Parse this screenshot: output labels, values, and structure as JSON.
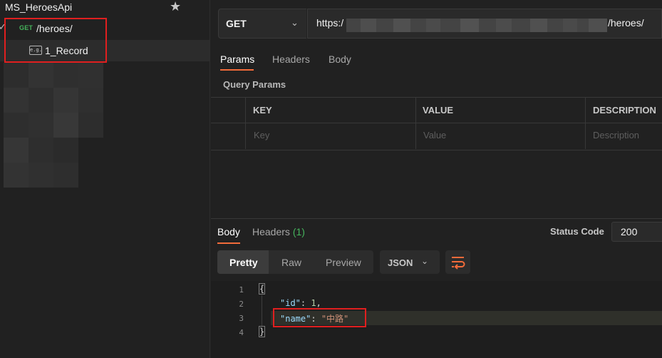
{
  "sidebar": {
    "collection_name": "MS_HeroesApi",
    "request": {
      "method": "GET",
      "path": "/heroes/"
    },
    "example": {
      "icon": "example-icon",
      "icon_text": "e.g.",
      "name": "1_Record"
    }
  },
  "request_bar": {
    "method": "GET",
    "url_prefix": "https:/",
    "url_suffix": "/heroes/"
  },
  "request_tabs": [
    "Params",
    "Headers",
    "Body"
  ],
  "query_params": {
    "label": "Query Params",
    "columns": [
      "KEY",
      "VALUE",
      "DESCRIPTION"
    ],
    "placeholders": [
      "Key",
      "Value",
      "Description"
    ]
  },
  "response": {
    "tabs": {
      "body": "Body",
      "headers": "Headers",
      "headers_count": "(1)"
    },
    "status_label": "Status Code",
    "status_value": "200",
    "view_modes": [
      "Pretty",
      "Raw",
      "Preview"
    ],
    "format": "JSON",
    "lines": [
      "1",
      "2",
      "3",
      "4"
    ],
    "code": {
      "open": "{",
      "key_id": "\"id\"",
      "val_id": "1",
      "key_name": "\"name\"",
      "val_name": "\"中路\"",
      "close": "}"
    }
  },
  "colors": {
    "accent": "#f26b3a",
    "get_method": "#45b35c",
    "highlight_box": "#e01f1f"
  }
}
